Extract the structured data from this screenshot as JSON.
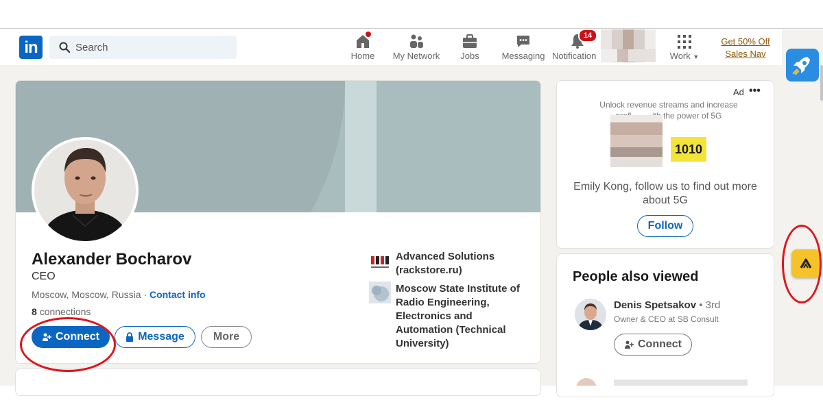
{
  "header": {
    "search_placeholder": "Search",
    "nav": [
      {
        "label": "Home",
        "icon": "home-icon",
        "badge": ""
      },
      {
        "label": "My Network",
        "icon": "network-icon"
      },
      {
        "label": "Jobs",
        "icon": "briefcase-icon"
      },
      {
        "label": "Messaging",
        "icon": "chat-icon"
      },
      {
        "label": "Notification",
        "icon": "bell-icon",
        "badge": "14"
      },
      {
        "label": "Work",
        "icon": "grid-icon"
      }
    ],
    "promo_line1": "Get 50% Off",
    "promo_line2": "Sales Nav"
  },
  "profile": {
    "name": "Alexander Bocharov",
    "headline": "CEO",
    "location": "Moscow, Moscow, Russia",
    "separator": "·",
    "contact_info": "Contact info",
    "connections_count": "8",
    "connections_label": "connections",
    "actions": {
      "connect": "Connect",
      "message": "Message",
      "more": "More"
    },
    "experience": [
      {
        "line1": "Advanced Solutions",
        "line2": "(rackstore.ru)"
      },
      {
        "line1": "Moscow State Institute of",
        "line2": "Radio Engineering,",
        "line3": "Electronics and",
        "line4": "Automation (Technical",
        "line5": "University)"
      }
    ]
  },
  "ad": {
    "label": "Ad",
    "menu": "•••",
    "line1": "Unlock revenue streams and increase",
    "line2": "profi         ith the power of 5G",
    "logo_text": "1010",
    "body_line1": "Emily Kong, follow us to find out more",
    "body_line2": "about 5G",
    "follow": "Follow"
  },
  "people_also_viewed": {
    "title": "People also viewed",
    "people": [
      {
        "name": "Denis Spetsakov",
        "degree": "• 3rd",
        "role": "Owner & CEO at SB Consult",
        "action": "Connect"
      }
    ]
  },
  "colors": {
    "brand": "#0a66c2",
    "annotation": "#e0141b",
    "page_bg": "#f3f2ef"
  }
}
